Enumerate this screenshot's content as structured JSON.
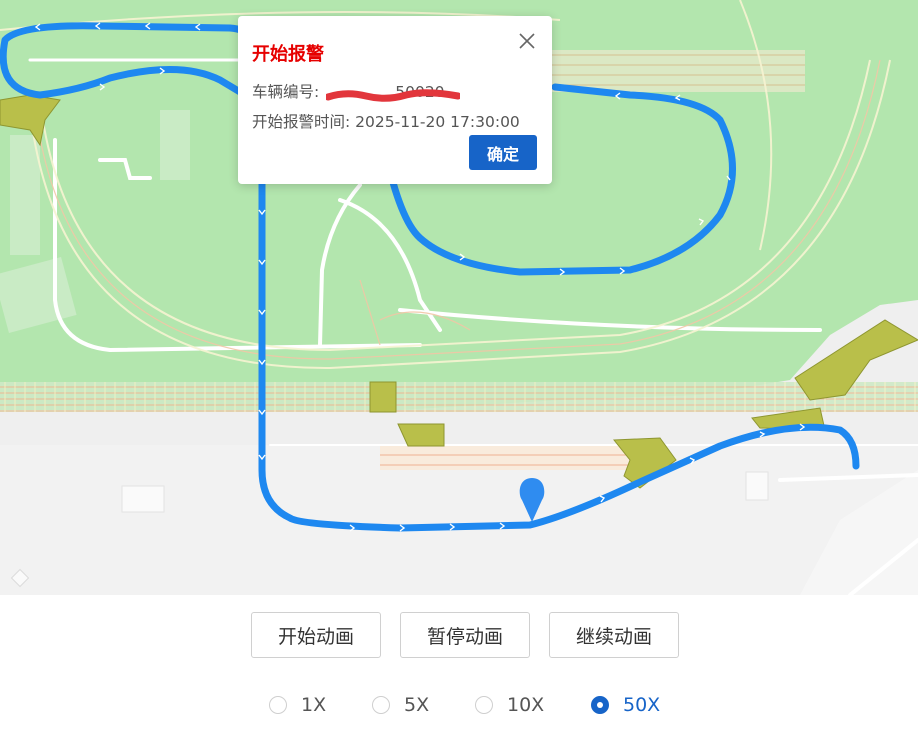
{
  "colors": {
    "route": "#1e88f0",
    "grass": "#b3e6ae",
    "ground": "#eeeeee",
    "pad": "#b9bf4a",
    "alert_title": "#e60000",
    "accent": "#1764c8"
  },
  "map": {
    "marker_icon": "map-pin-icon"
  },
  "popup": {
    "title": "开始报警",
    "vehicle_label": "车辆编号:",
    "vehicle_value_visible": "50020",
    "start_time_label": "开始报警时间:",
    "start_time_value": "2025-11-20 17:30:00",
    "confirm_label": "确定",
    "close_icon": "close-icon"
  },
  "controls": {
    "start_label": "开始动画",
    "pause_label": "暂停动画",
    "resume_label": "继续动画"
  },
  "speed": {
    "selected": "50X",
    "options": [
      "1X",
      "5X",
      "10X",
      "50X"
    ]
  }
}
